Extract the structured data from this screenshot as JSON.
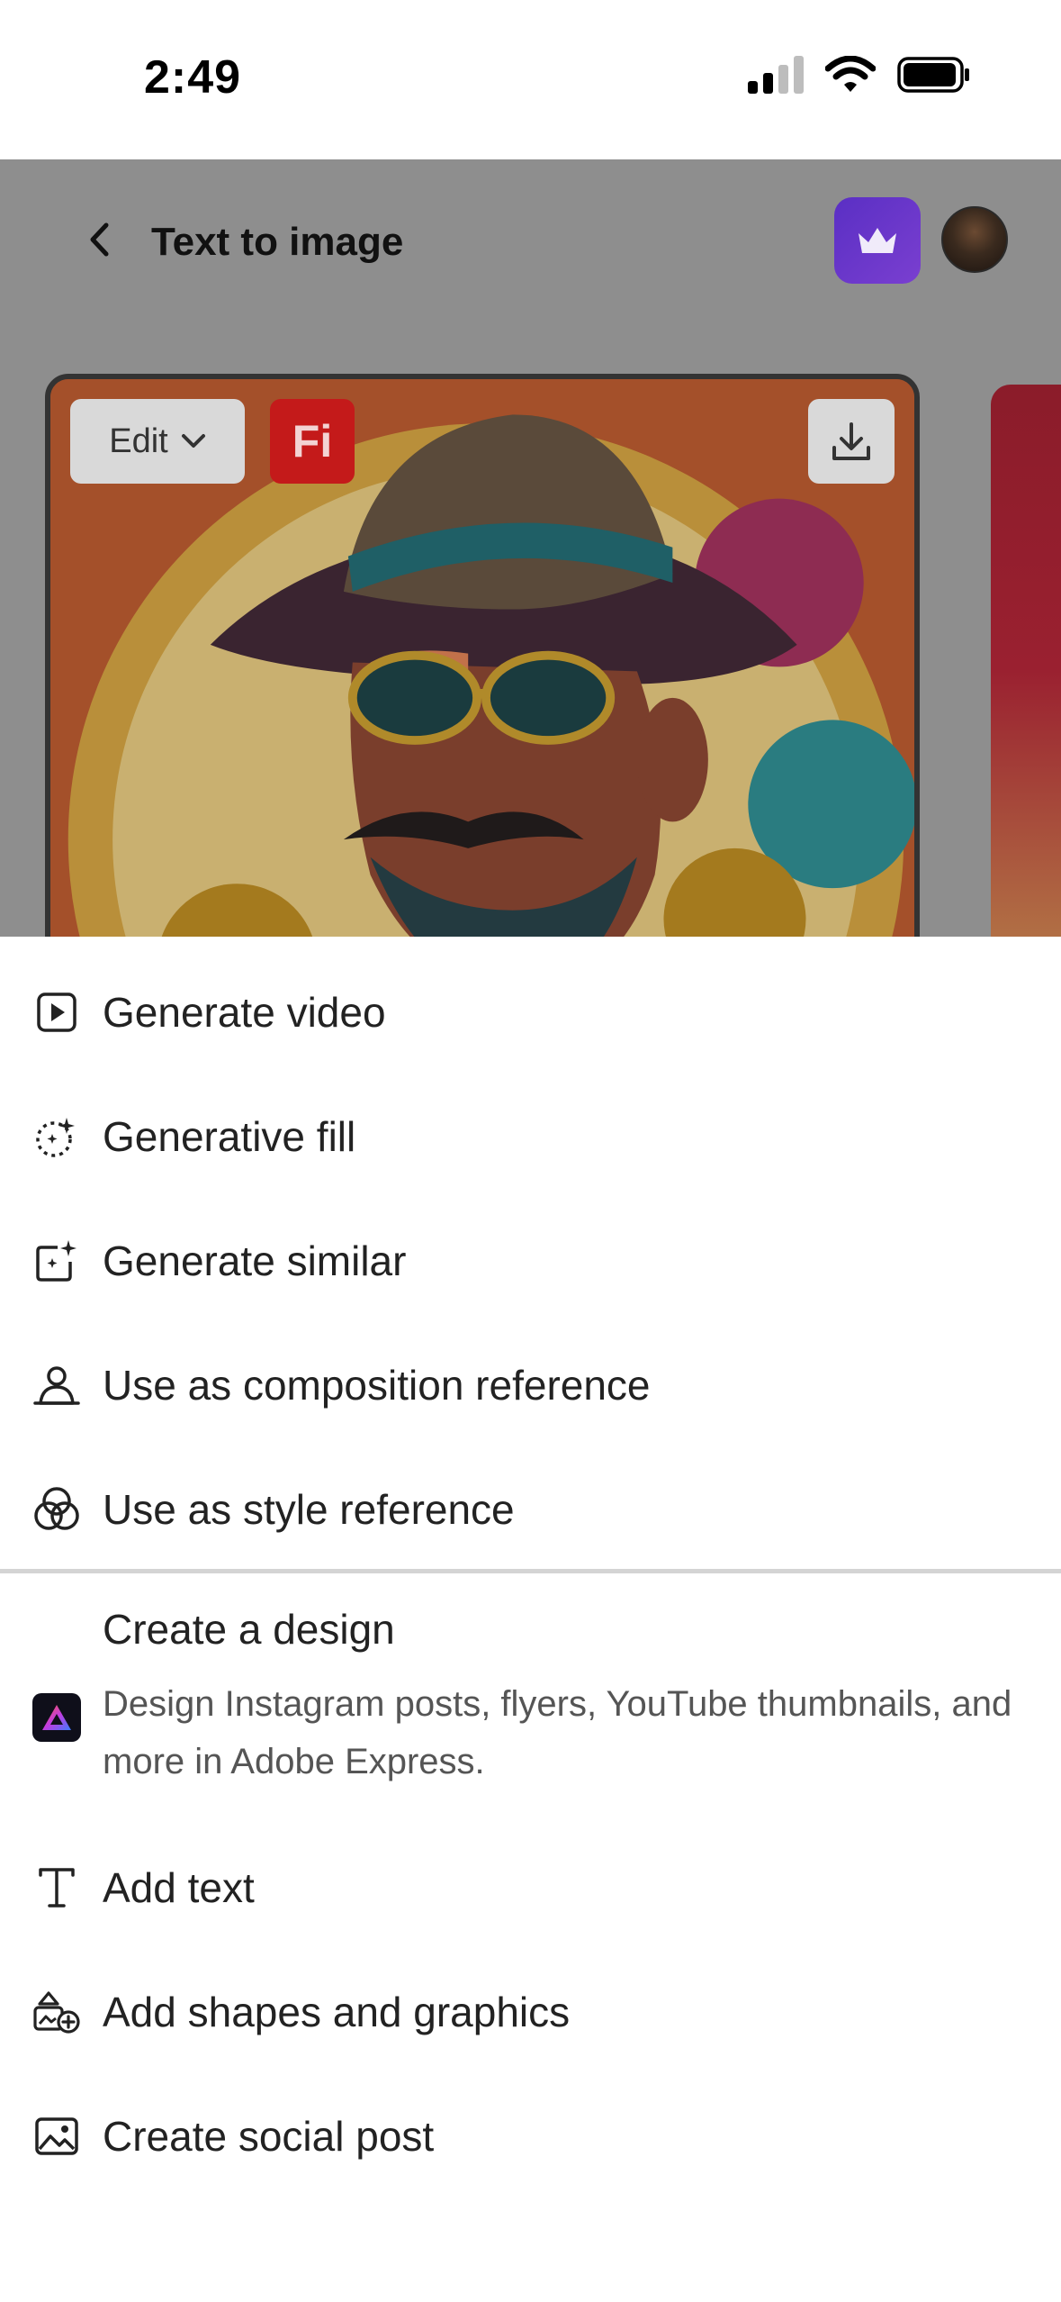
{
  "status_bar": {
    "time": "2:49",
    "icons": [
      "cellular-signal-icon",
      "wifi-icon",
      "battery-icon"
    ]
  },
  "header": {
    "back_icon": "chevron-left-icon",
    "title": "Text to image",
    "premium_icon": "crown-icon",
    "premium_color": "#6a35cc",
    "avatar": "user-avatar"
  },
  "card": {
    "edit_label": "Edit",
    "edit_icon": "chevron-down-icon",
    "badge_text": "Fi",
    "badge_color": "#c41a1a",
    "download_icon": "download-icon",
    "image_description_icon": "generated-image"
  },
  "menu": {
    "items": [
      {
        "label": "Generate video",
        "icon": "play-video-icon"
      },
      {
        "label": "Generative fill",
        "icon": "generative-fill-icon"
      },
      {
        "label": "Generate similar",
        "icon": "generate-similar-icon"
      },
      {
        "label": "Use as composition reference",
        "icon": "composition-reference-icon"
      },
      {
        "label": "Use as style reference",
        "icon": "style-reference-icon"
      }
    ],
    "design": {
      "title": "Create a design",
      "description": "Design Instagram posts, flyers, YouTube thumbnails, and more in Adobe Express.",
      "icon": "adobe-express-icon"
    },
    "more_items": [
      {
        "label": "Add text",
        "icon": "text-icon"
      },
      {
        "label": "Add shapes and graphics",
        "icon": "shapes-icon"
      },
      {
        "label": "Create social post",
        "icon": "image-icon"
      }
    ]
  }
}
